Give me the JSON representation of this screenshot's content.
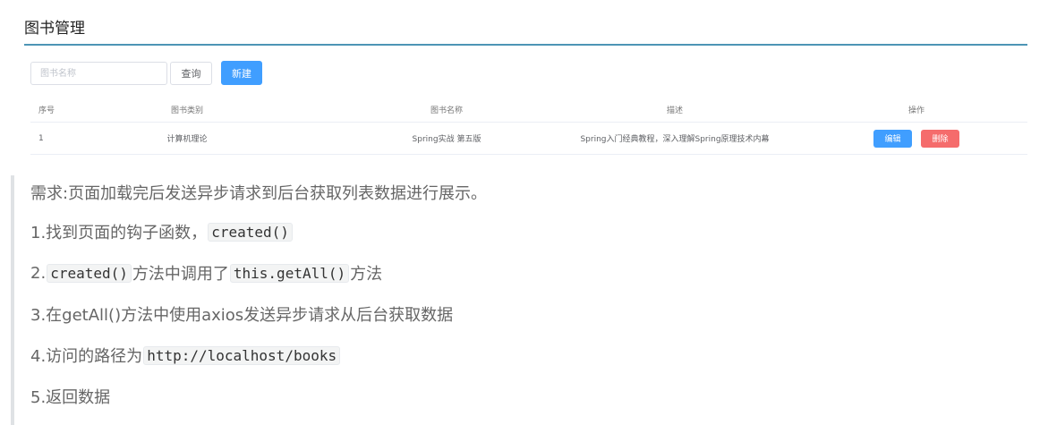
{
  "panel": {
    "title": "图书管理",
    "search_placeholder": "图书名称",
    "query_label": "查询",
    "new_label": "新建",
    "table": {
      "headers": [
        "序号",
        "图书类别",
        "图书名称",
        "描述",
        "操作"
      ],
      "rows": [
        {
          "seq": "1",
          "type": "计算机理论",
          "name": "Spring实战 第五版",
          "desc": "Spring入门经典教程，深入理解Spring原理技术内幕"
        }
      ],
      "edit_label": "编辑",
      "delete_label": "删除"
    }
  },
  "notes": {
    "line0": "需求:页面加载完后发送异步请求到后台获取列表数据进行展示。",
    "line1_prefix": "1.找到页面的钩子函数，",
    "line1_code": "created()",
    "line2_prefix": "2.",
    "line2_code1": "created()",
    "line2_mid": "方法中调用了",
    "line2_code2": "this.getAll()",
    "line2_suffix": "方法",
    "line3": "3.在getAll()方法中使用axios发送异步请求从后台获取数据",
    "line4_prefix": "4.访问的路径为",
    "line4_code": "http://localhost/books",
    "line5": "5.返回数据"
  },
  "colors": {
    "accent": "#409eff",
    "danger": "#f56c6c",
    "title_rule": "#4d95b5"
  }
}
